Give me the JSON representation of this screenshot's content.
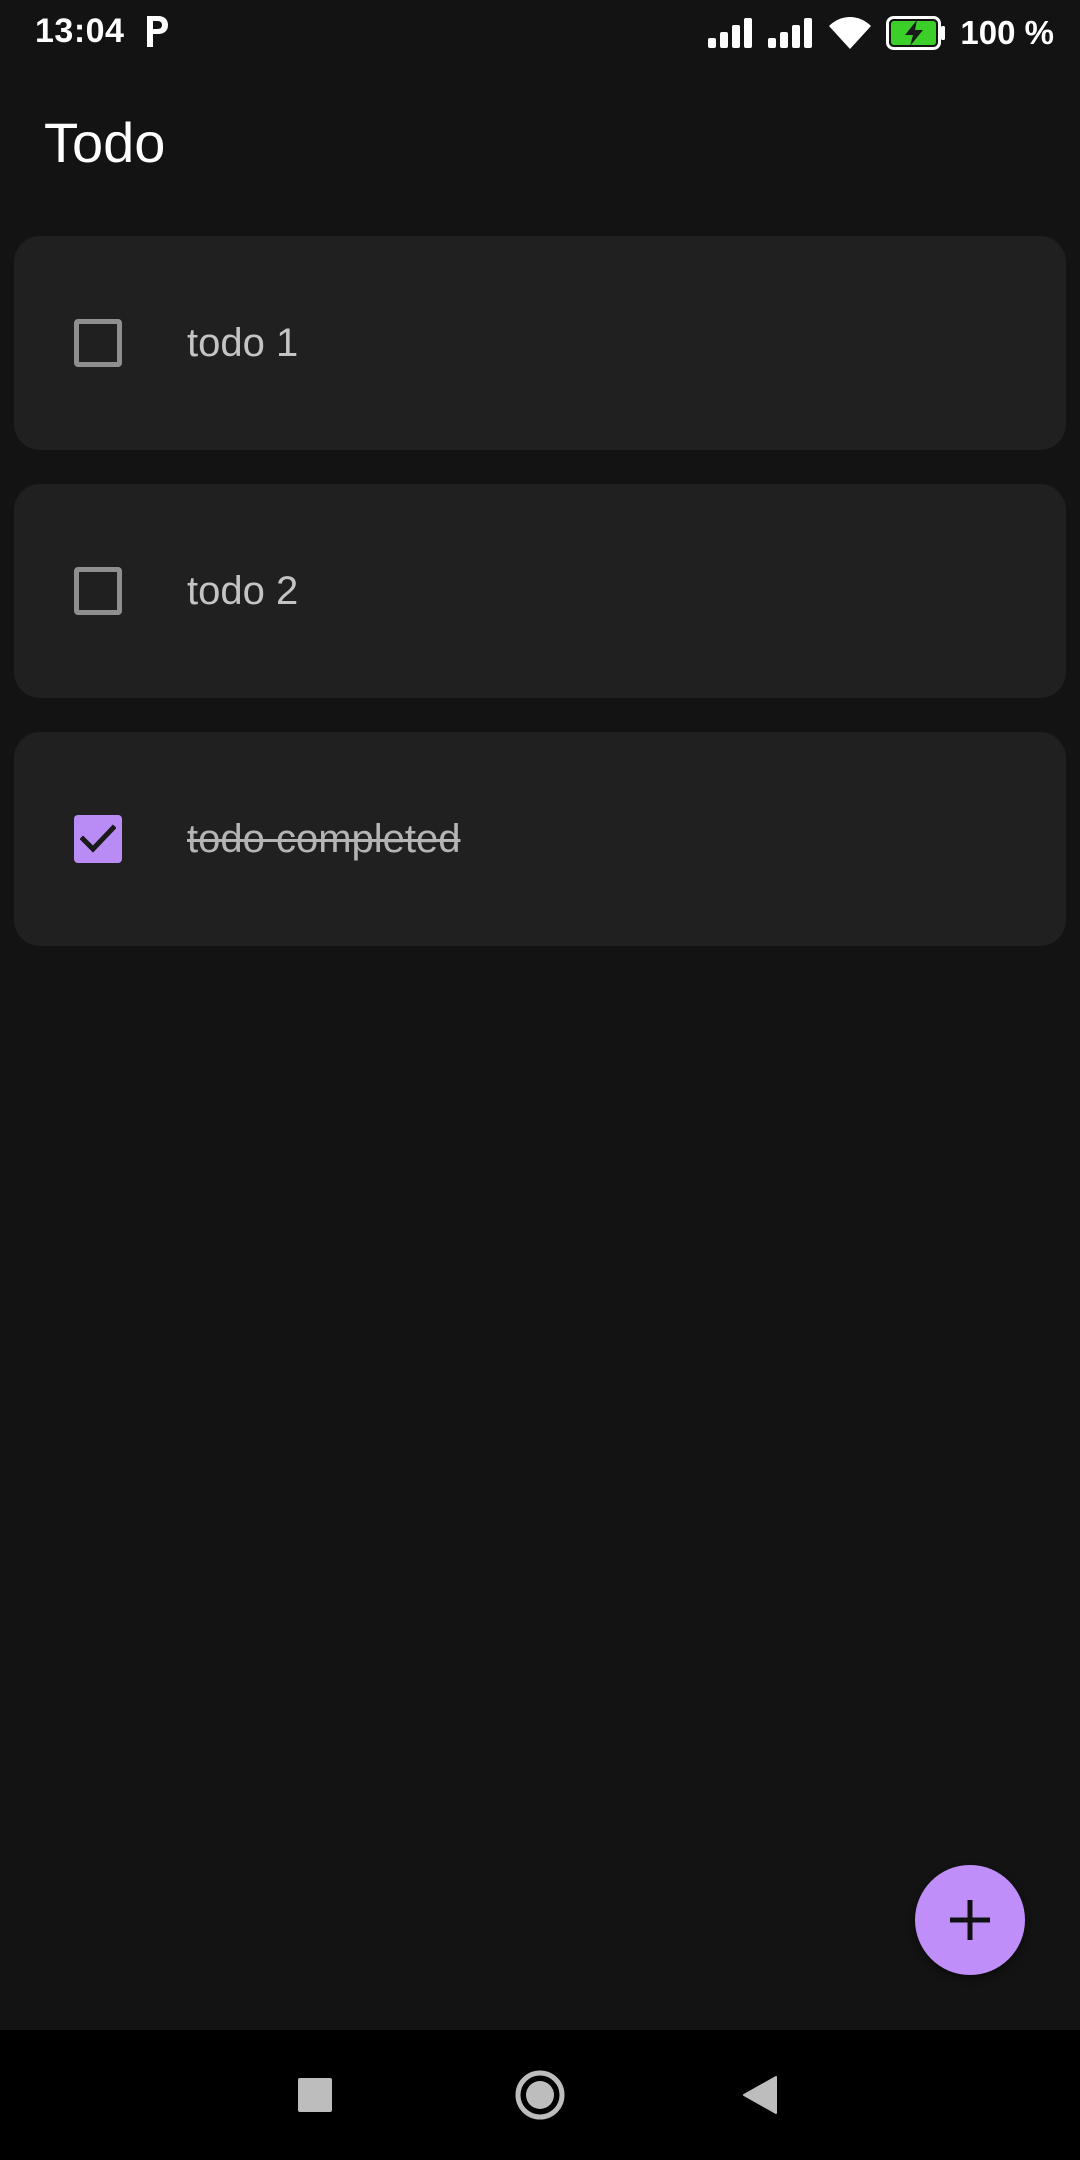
{
  "status_bar": {
    "time": "13:04",
    "battery_text": "100 %",
    "icons": [
      "parking-icon",
      "signal-icon",
      "signal-icon",
      "wifi-icon",
      "battery-charging-icon"
    ],
    "battery_color": "#3ccf2a"
  },
  "app": {
    "title": "Todo"
  },
  "todos": [
    {
      "text": "todo 1",
      "completed": false
    },
    {
      "text": "todo 2",
      "completed": false
    },
    {
      "text": "todo completed",
      "completed": true
    }
  ],
  "fab": {
    "icon": "plus-icon",
    "color": "#c08ef8"
  },
  "nav": {
    "icons": [
      "recents-square-icon",
      "home-circle-icon",
      "back-triangle-icon"
    ]
  },
  "colors": {
    "accent": "#b98cf5",
    "background": "#131313",
    "card": "#202020"
  }
}
